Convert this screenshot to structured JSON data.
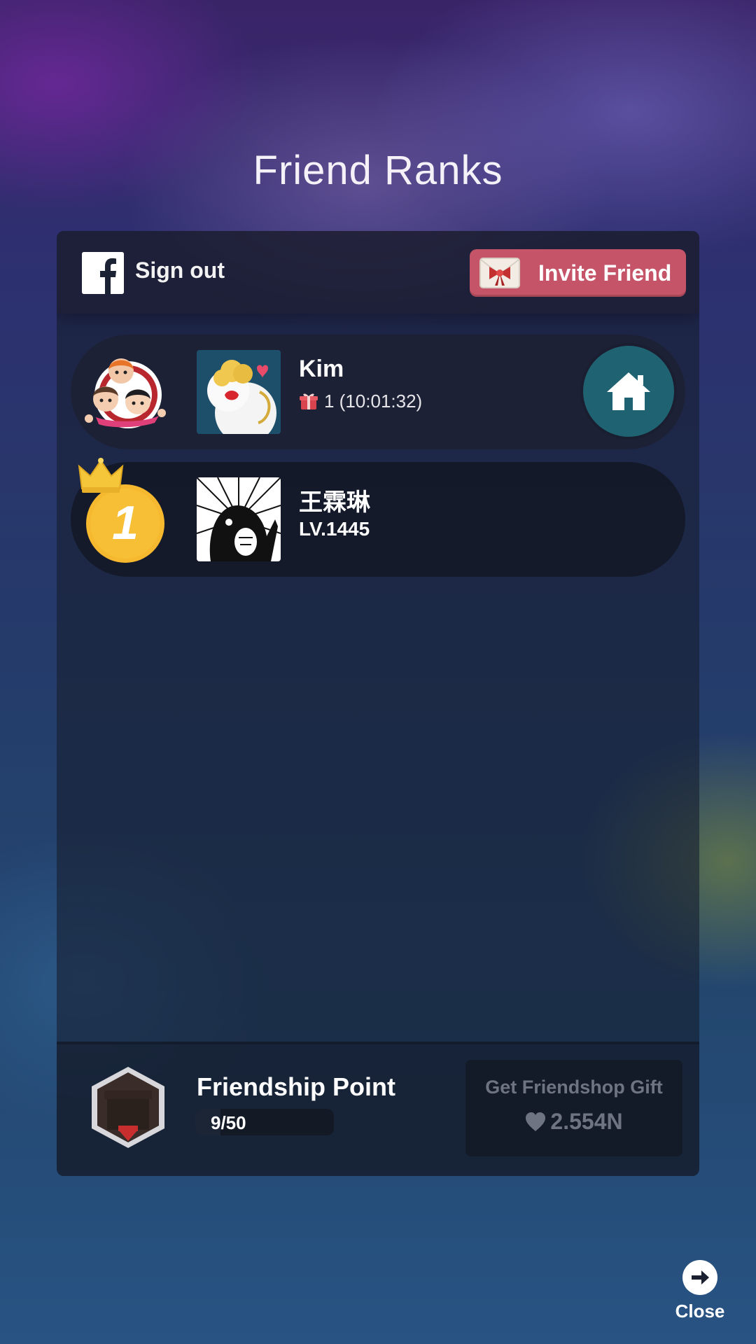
{
  "title": "Friend Ranks",
  "header": {
    "signout_label": "Sign out",
    "invite_label": "Invite Friend"
  },
  "friends": [
    {
      "name": "Kim",
      "gift_info": "1 (10:01:32)"
    },
    {
      "rank": "1",
      "name": "王霖琳",
      "level": "LV.1445"
    }
  ],
  "footer": {
    "friendship_label": "Friendship Point",
    "friendship_progress": "9/50",
    "friendship_fraction": 0.18,
    "gift_button_label": "Get Friendshop Gift",
    "gift_button_value": "2.554N"
  },
  "close_label": "Close",
  "colors": {
    "invite_button": "#c65468",
    "home_button": "#1f6373",
    "rank_gold": "#f5b82e"
  },
  "icons": {
    "facebook": "facebook-icon",
    "invite": "envelope-bow-icon",
    "gift": "gift-icon",
    "home": "home-icon",
    "crown": "crown-icon",
    "heart": "heart-icon",
    "close": "arrow-right-icon"
  }
}
